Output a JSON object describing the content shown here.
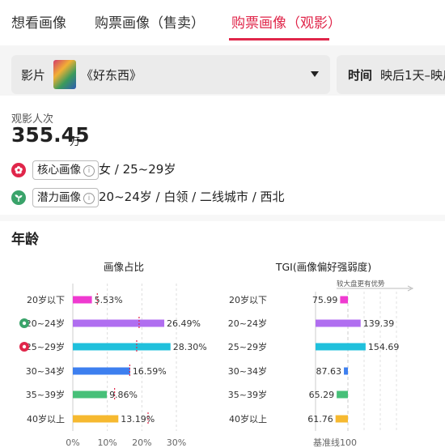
{
  "tabs": [
    {
      "label": "想看画像"
    },
    {
      "label": "购票画像（售卖）"
    },
    {
      "label": "购票画像（观影）"
    }
  ],
  "active_tab_index": 2,
  "filters": {
    "movie_label": "影片",
    "movie_value": "《好东西》",
    "time_label": "时间",
    "time_value": "映后1天–映后"
  },
  "stats": {
    "label": "观影人次",
    "value": "355.45",
    "unit": "万"
  },
  "profiles": {
    "core": {
      "tag": "核心画像",
      "value": "女 / 25~29岁"
    },
    "potential": {
      "tag": "潜力画像",
      "value": "20~24岁 / 白领 / 二线城市 / 西北"
    }
  },
  "section": {
    "title": "年龄"
  },
  "colors": {
    "accent": "#e0264a",
    "core_icon": "#e0264a",
    "potential_icon": "#3aa36a"
  },
  "chart_data": [
    {
      "type": "bar",
      "orientation": "horizontal",
      "title": "画像占比",
      "categories": [
        "20岁以下",
        "20~24岁",
        "25~29岁",
        "30~34岁",
        "35~39岁",
        "40岁以上"
      ],
      "values": [
        5.53,
        26.49,
        28.3,
        16.59,
        9.86,
        13.19
      ],
      "value_labels": [
        "5.53%",
        "26.49%",
        "28.30%",
        "16.59%",
        "9.86%",
        "13.19%"
      ],
      "benchmark_values": [
        7.1,
        19.2,
        18.5,
        16.5,
        12.1,
        21.8
      ],
      "colors": [
        "#ef3ad0",
        "#b06ef0",
        "#20c0dc",
        "#3d7fef",
        "#47c079",
        "#f6b930"
      ],
      "xticks": [
        "0%",
        "10%",
        "20%",
        "30%"
      ],
      "xlim": [
        0,
        30
      ],
      "category_icons": [
        "",
        "potential",
        "core",
        "",
        "",
        ""
      ]
    },
    {
      "type": "bar",
      "orientation": "horizontal",
      "title": "TGI(画像偏好强弱度)",
      "subtitle": "较大盘更有优势",
      "categories": [
        "20岁以下",
        "20~24岁",
        "25~29岁",
        "30~34岁",
        "35~39岁",
        "40岁以上"
      ],
      "values": [
        75.99,
        139.39,
        154.69,
        87.63,
        65.29,
        61.76
      ],
      "value_labels": [
        "75.99",
        "139.39",
        "154.69",
        "87.63",
        "65.29",
        "61.76"
      ],
      "baseline": 100,
      "baseline_label": "基准线100",
      "colors": [
        "#ef3ad0",
        "#b06ef0",
        "#20c0dc",
        "#3d7fef",
        "#47c079",
        "#f6b930"
      ]
    }
  ]
}
